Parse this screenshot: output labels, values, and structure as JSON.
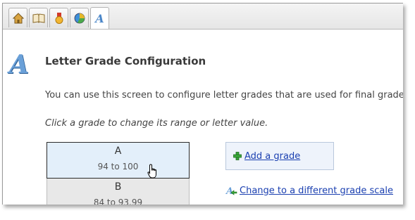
{
  "tabs": [
    {
      "icon": "home-icon"
    },
    {
      "icon": "book-icon"
    },
    {
      "icon": "medal-icon"
    },
    {
      "icon": "pie-chart-icon"
    },
    {
      "icon": "letter-grade-icon",
      "glyph": "A",
      "active": true
    }
  ],
  "header": {
    "icon_glyph": "A",
    "title": "Letter Grade Configuration"
  },
  "description": "You can use this screen to configure letter grades that are used for final grade",
  "hint": "Click a grade to change its range or letter value.",
  "grades": [
    {
      "letter": "A",
      "range": "94 to 100",
      "selected": true
    },
    {
      "letter": "B",
      "range": "84 to 93.99"
    }
  ],
  "actions": {
    "add_grade": "Add a grade",
    "change_scale": "Change to a different grade scale"
  },
  "colors": {
    "link": "#1a3fb0",
    "selected_grade_bg": "#e3effa",
    "accent_blue": "#6aa0d8"
  }
}
